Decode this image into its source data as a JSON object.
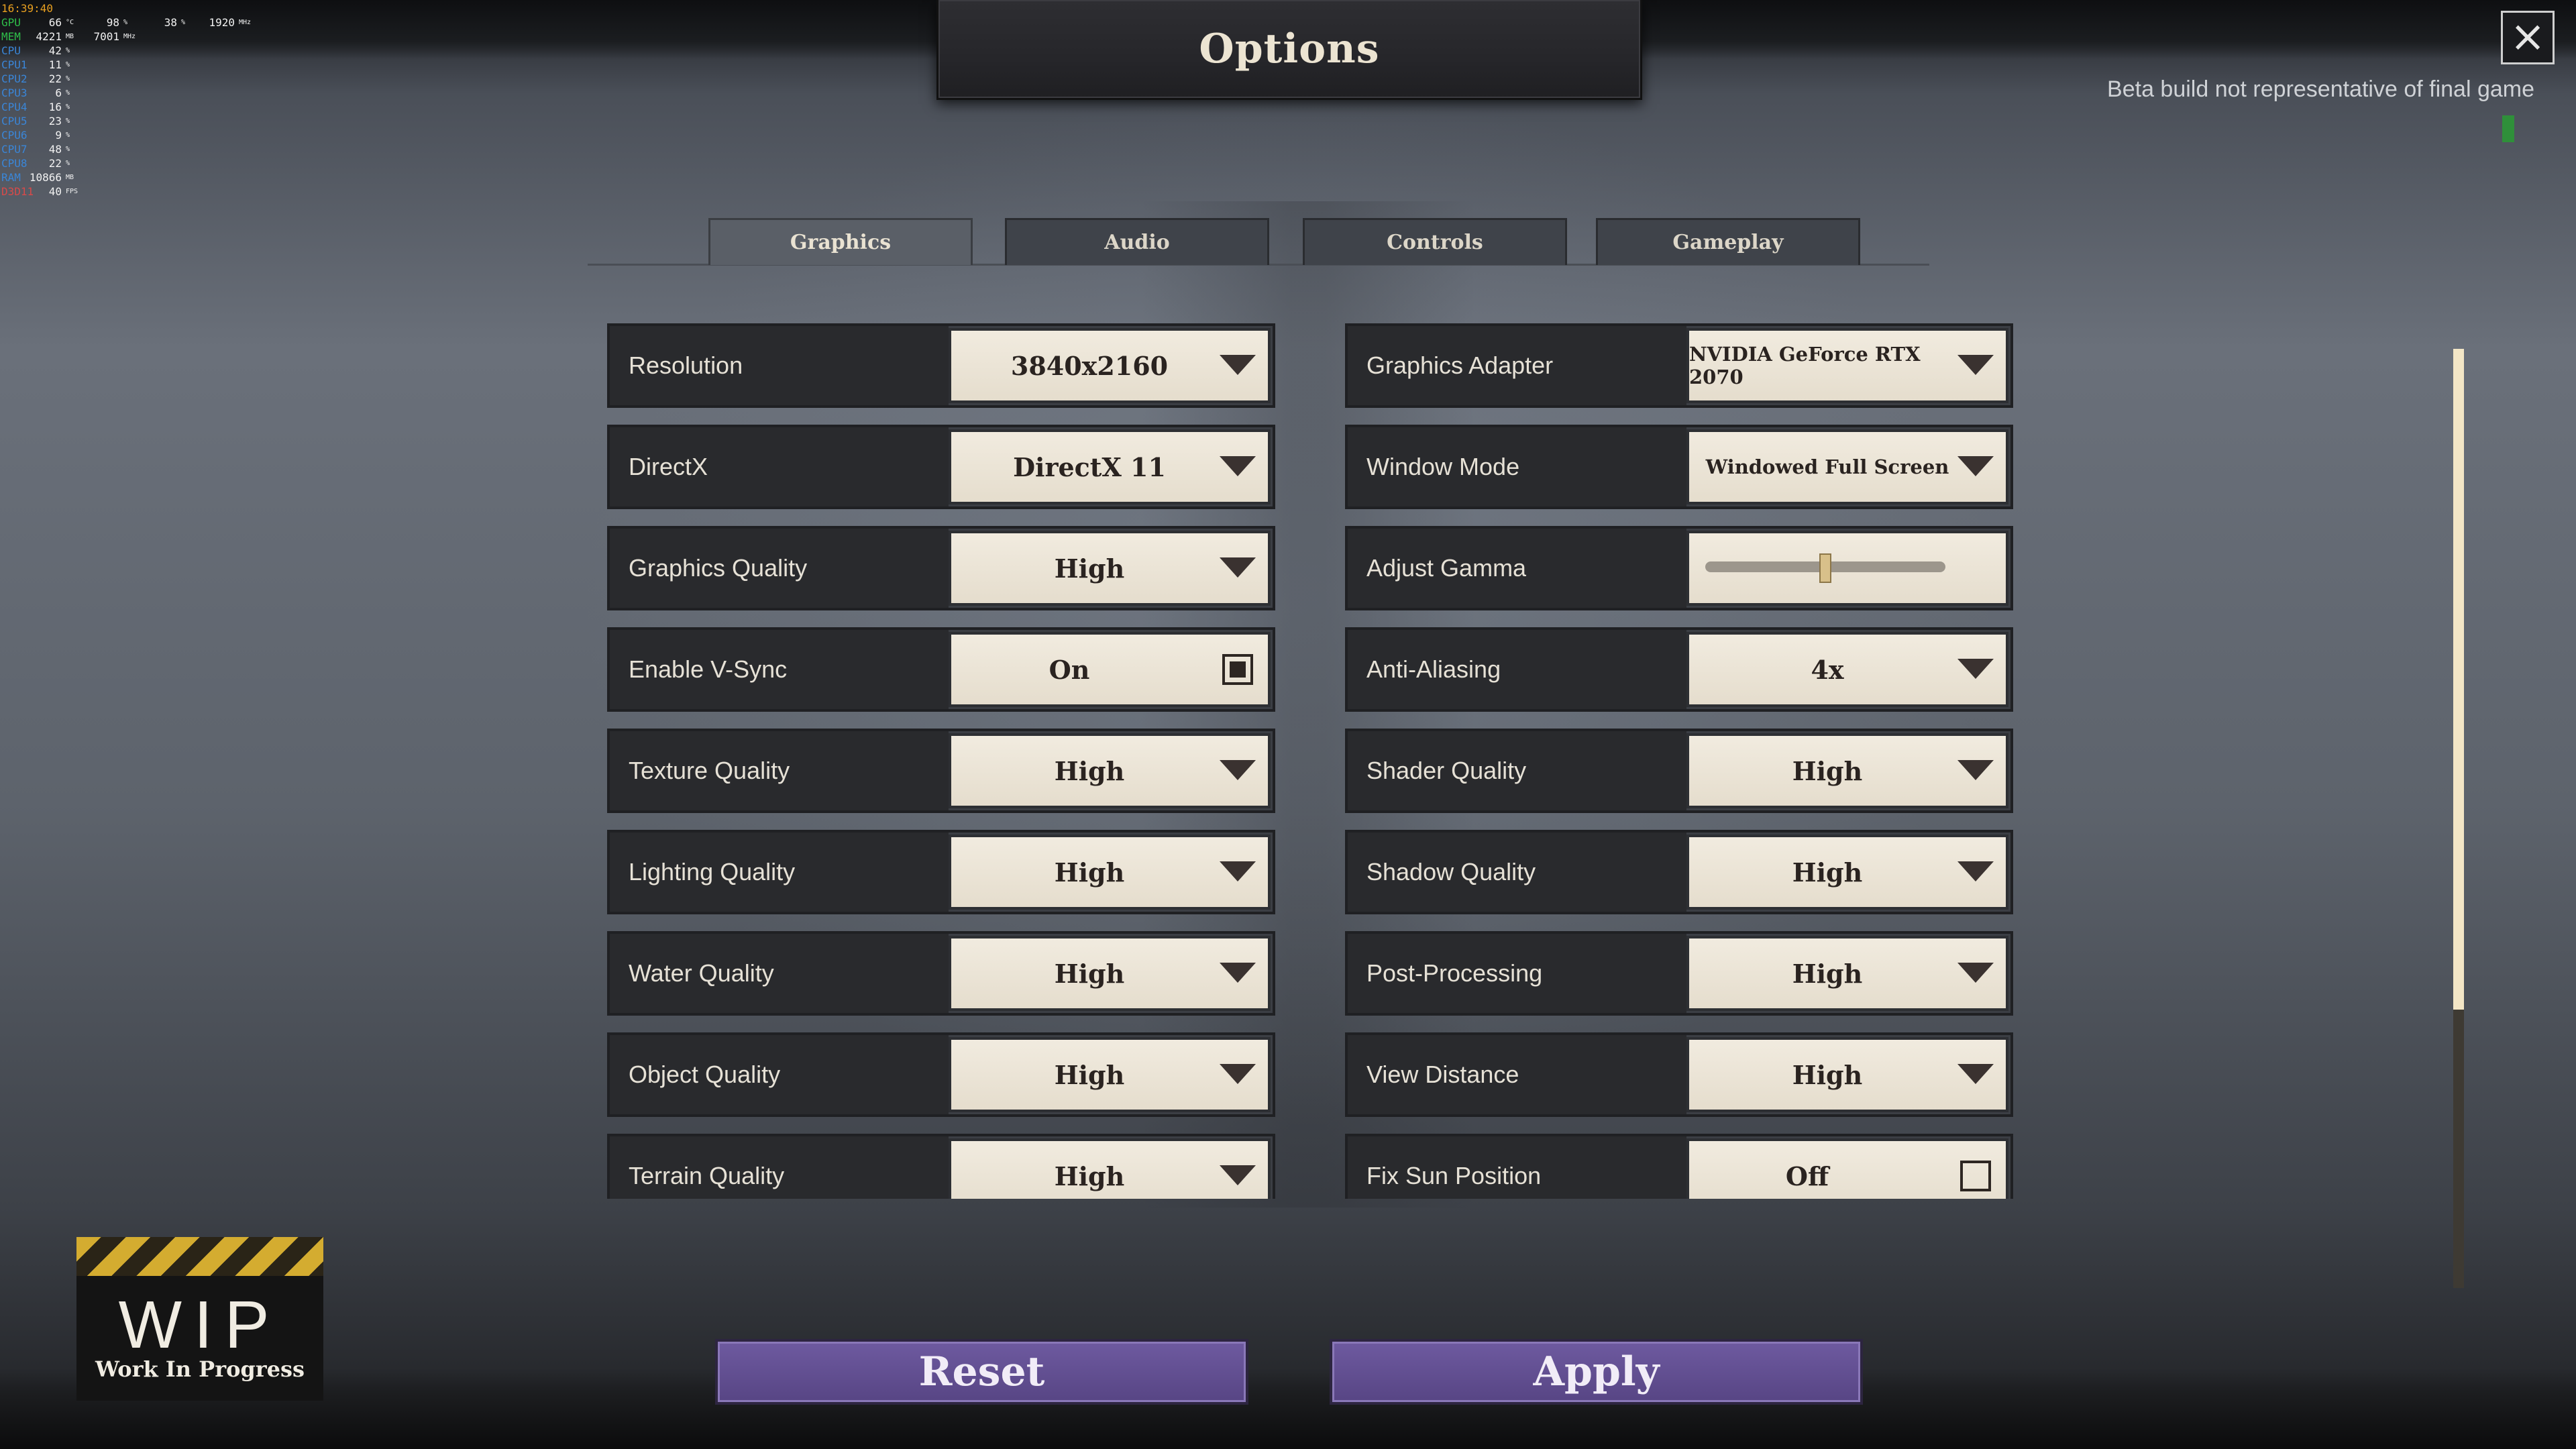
{
  "hud": {
    "clock": "16:39:40",
    "rows": [
      {
        "label": "GPU",
        "value": "66",
        "unit": "°C",
        "value2": "98",
        "unit2": "%",
        "value3": "38",
        "unit3": "%",
        "value4": "1920",
        "unit4": "MHz"
      },
      {
        "label": "MEM",
        "value": "4221",
        "unit": "MB",
        "value2": "7001",
        "unit2": "MHz"
      },
      {
        "label": "CPU",
        "value": "42",
        "unit": "%"
      },
      {
        "label": "CPU1",
        "value": "11",
        "unit": "%"
      },
      {
        "label": "CPU2",
        "value": "22",
        "unit": "%"
      },
      {
        "label": "CPU3",
        "value": "6",
        "unit": "%"
      },
      {
        "label": "CPU4",
        "value": "16",
        "unit": "%"
      },
      {
        "label": "CPU5",
        "value": "23",
        "unit": "%"
      },
      {
        "label": "CPU6",
        "value": "9",
        "unit": "%"
      },
      {
        "label": "CPU7",
        "value": "48",
        "unit": "%"
      },
      {
        "label": "CPU8",
        "value": "22",
        "unit": "%"
      },
      {
        "label": "RAM",
        "value": "10866",
        "unit": "MB"
      },
      {
        "label": "D3D11",
        "value": "40",
        "unit": "FPS"
      }
    ]
  },
  "title": "Options",
  "close_icon": "×",
  "beta_note": "Beta build not representative of final game",
  "tabs": [
    {
      "label": "Graphics",
      "active": true
    },
    {
      "label": "Audio",
      "active": false
    },
    {
      "label": "Controls",
      "active": false
    },
    {
      "label": "Gameplay",
      "active": false
    }
  ],
  "settings_left": [
    {
      "label": "Resolution",
      "value": "3840x2160",
      "type": "dropdown"
    },
    {
      "label": "DirectX",
      "value": "DirectX 11",
      "type": "dropdown"
    },
    {
      "label": "Graphics Quality",
      "value": "High",
      "type": "dropdown"
    },
    {
      "label": "Enable V-Sync",
      "value": "On",
      "type": "checkbox",
      "checked": true
    },
    {
      "label": "Texture Quality",
      "value": "High",
      "type": "dropdown"
    },
    {
      "label": "Lighting Quality",
      "value": "High",
      "type": "dropdown"
    },
    {
      "label": "Water Quality",
      "value": "High",
      "type": "dropdown"
    },
    {
      "label": "Object Quality",
      "value": "High",
      "type": "dropdown"
    },
    {
      "label": "Terrain Quality",
      "value": "High",
      "type": "dropdown"
    }
  ],
  "settings_right": [
    {
      "label": "Graphics Adapter",
      "value": "NVIDIA GeForce RTX 2070",
      "type": "dropdown"
    },
    {
      "label": "Window Mode",
      "value": "Windowed Full Screen",
      "type": "dropdown"
    },
    {
      "label": "Adjust Gamma",
      "value": "",
      "type": "slider",
      "level": 0.5
    },
    {
      "label": "Anti-Aliasing",
      "value": "4x",
      "type": "dropdown"
    },
    {
      "label": "Shader Quality",
      "value": "High",
      "type": "dropdown"
    },
    {
      "label": "Shadow Quality",
      "value": "High",
      "type": "dropdown"
    },
    {
      "label": "Post-Processing",
      "value": "High",
      "type": "dropdown"
    },
    {
      "label": "View Distance",
      "value": "High",
      "type": "dropdown"
    },
    {
      "label": "Fix Sun Position",
      "value": "Off",
      "type": "checkbox",
      "checked": false
    }
  ],
  "buttons": {
    "reset": "Reset",
    "apply": "Apply"
  },
  "wip": {
    "big": "WIP",
    "small": "Work In Progress"
  },
  "colors": {
    "accent_purple": "#6e5aa0",
    "panel_cream": "#ede6d8",
    "active_tab": "#5a5f67"
  }
}
